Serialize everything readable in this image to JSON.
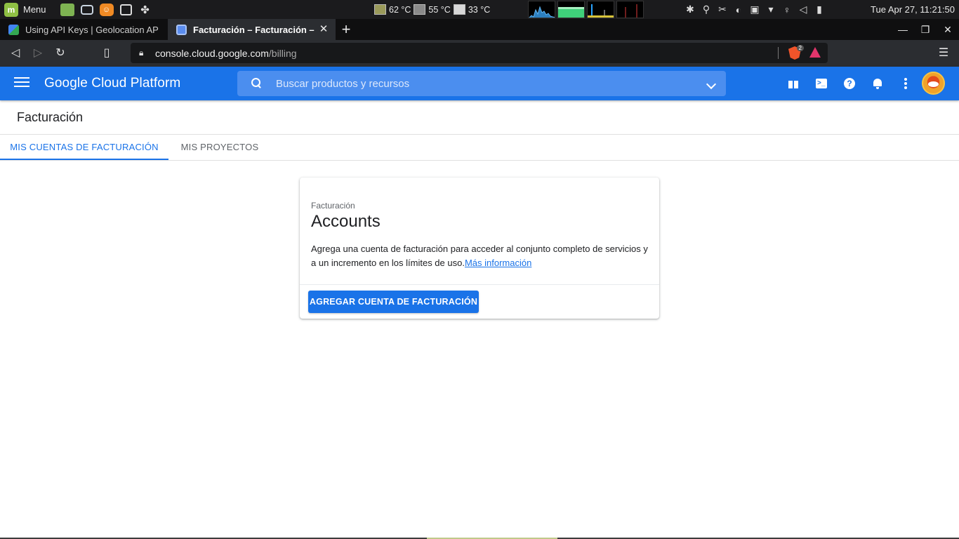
{
  "os_panel": {
    "menu_label": "Menu",
    "temps": [
      "62 °C",
      "55 °C",
      "33 °C"
    ],
    "clock": "Tue Apr 27, 11:21:50"
  },
  "browser": {
    "tabs": [
      {
        "title": "Using API Keys  |  Geolocation API",
        "active": false
      },
      {
        "title": "Facturación – Facturación – Google Cloud Platform",
        "active": true
      }
    ],
    "url_host": "console.cloud.google.com",
    "url_path": "/billing",
    "brave_badge": "2"
  },
  "gcp_header": {
    "title": "Google Cloud Platform",
    "search_placeholder": "Buscar productos y recursos"
  },
  "page": {
    "title": "Facturación",
    "tabs": [
      "MIS CUENTAS DE FACTURACIÓN",
      "MIS PROYECTOS"
    ],
    "card": {
      "eyebrow": "Facturación",
      "heading": "Accounts",
      "body": "Agrega una cuenta de facturación para acceder al conjunto completo de servicios y a un incremento en los límites de uso.",
      "link": "Más información",
      "button": "AGREGAR CUENTA DE FACTURACIÓN"
    }
  },
  "colors": {
    "gcp_blue": "#1a73e8",
    "os_panel": "#1b1b1d",
    "browser_chrome": "#2b2d31"
  }
}
